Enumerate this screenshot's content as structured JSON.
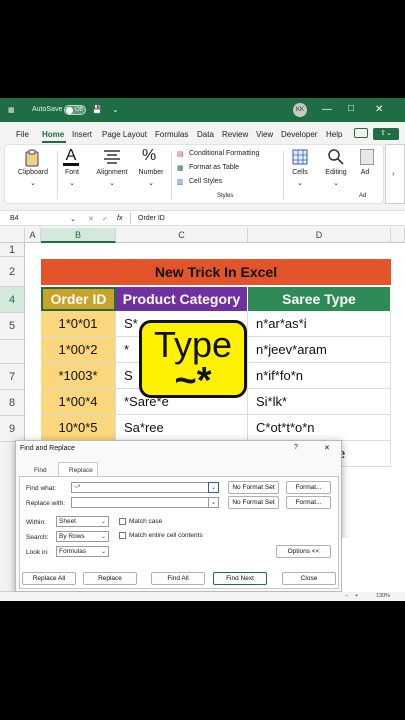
{
  "titlebar": {
    "autosave_label": "AutoSave",
    "autosave_state": "Off",
    "user_initials": "KK",
    "minimize_glyph": "—",
    "maximize_glyph": "□",
    "close_glyph": "✕"
  },
  "menu": {
    "items": [
      "File",
      "Home",
      "Insert",
      "Page Layout",
      "Formulas",
      "Data",
      "Review",
      "View",
      "Developer",
      "Help"
    ],
    "active": "Home"
  },
  "ribbon": {
    "clipboard": "Clipboard",
    "font": "Font",
    "alignment": "Alignment",
    "number": "Number",
    "number_symbol": "%",
    "conditional_formatting": "Conditional Formatting",
    "format_as_table": "Format as Table",
    "cell_styles": "Cell Styles",
    "styles_group": "Styles",
    "cells": "Cells",
    "editing": "Editing",
    "addins_short": "Ad",
    "addins_group_short": "Ad"
  },
  "formula_bar": {
    "name_box": "B4",
    "fx": "fx",
    "content": "Order ID"
  },
  "grid": {
    "columns": [
      "A",
      "B",
      "C",
      "D"
    ],
    "selected_column": "B",
    "rows": [
      "1",
      "2",
      "4",
      "5",
      "7",
      "8",
      "9"
    ],
    "selected_row": "4",
    "title": "New Trick In Excel",
    "headers": [
      "Order ID",
      "Product Category",
      "Saree Type"
    ],
    "header_colors": [
      "#c9a227",
      "#7030a0",
      "#2e8b57"
    ],
    "data": [
      [
        "1*0*01",
        "S*",
        "n*ar*as*i"
      ],
      [
        "1*00*2",
        "*",
        "n*jeev*aram"
      ],
      [
        "*1003*",
        "S",
        "n*if*fo*n"
      ],
      [
        "1*00*4",
        "*Sare*e",
        "Si*lk*"
      ],
      [
        "10*0*5",
        "Sa*ree",
        "C*ot*t*o*n"
      ]
    ],
    "partial_row": [
      "",
      "",
      "e"
    ]
  },
  "overlay": {
    "line1": "Type",
    "line2": "~*"
  },
  "dialog": {
    "title": "Find and Replace",
    "help": "?",
    "close": "✕",
    "tabs": [
      "Find",
      "Replace"
    ],
    "active_tab": "Replace",
    "find_what_label": "Find what:",
    "find_what_value": "~*",
    "replace_with_label": "Replace with:",
    "replace_with_value": "",
    "no_format_set": "No Format Set",
    "format_button": "Format...",
    "within_label": "Within:",
    "within_value": "Sheet",
    "search_label": "Search:",
    "search_value": "By Rows",
    "lookin_label": "Look in:",
    "lookin_value": "Formulas",
    "match_case": "Match case",
    "match_entire": "Match entire cell contents",
    "options_button": "Options <<",
    "buttons": [
      "Replace All",
      "Replace",
      "Find All",
      "Find Next",
      "Close"
    ]
  },
  "status": {
    "zoom": "130%"
  }
}
